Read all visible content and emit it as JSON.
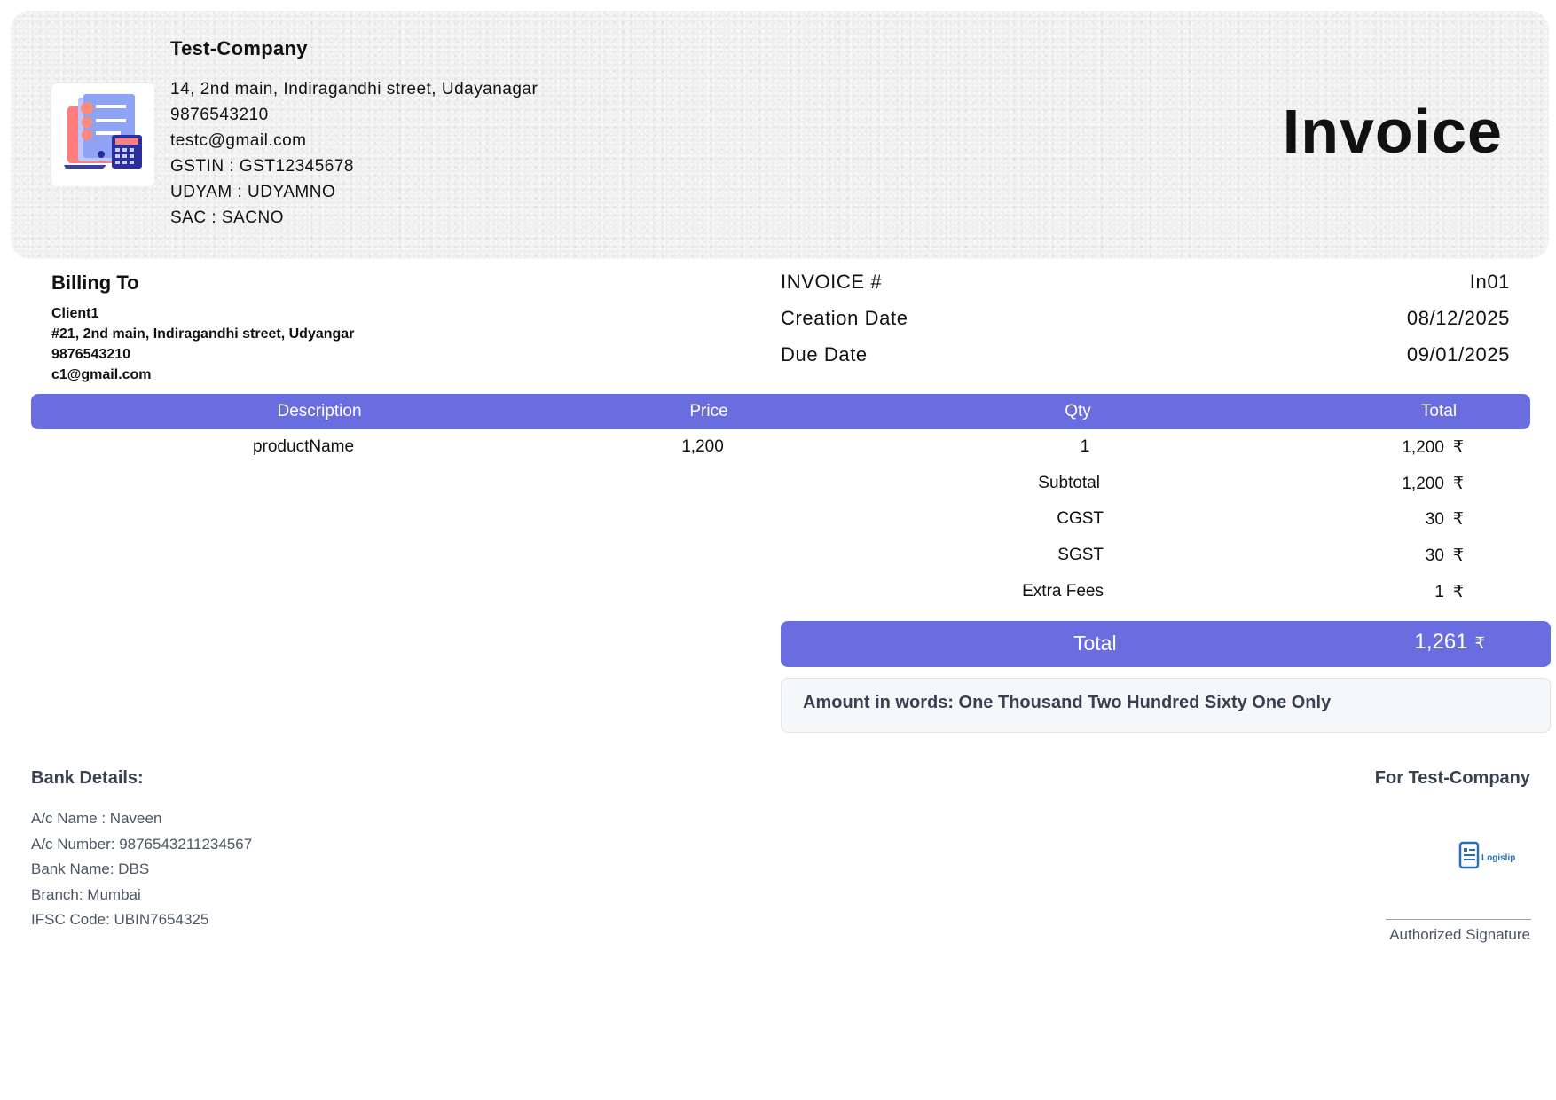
{
  "header": {
    "company_name": "Test-Company",
    "address": "14, 2nd main, Indiragandhi street, Udayanagar",
    "phone": "9876543210",
    "email": "testc@gmail.com",
    "gstin": "GSTIN : GST12345678",
    "udyam": "UDYAM : UDYAMNO",
    "sac": "SAC : SACNO",
    "title": "Invoice"
  },
  "billing": {
    "title": "Billing To",
    "client_name": "Client1",
    "address": "#21, 2nd main, Indiragandhi street, Udyangar",
    "phone": "9876543210",
    "email": "c1@gmail.com"
  },
  "meta": {
    "invoice_label": "INVOICE #",
    "invoice_value": "In01",
    "creation_label": "Creation Date",
    "creation_value": "08/12/2025",
    "due_label": "Due Date",
    "due_value": "09/01/2025"
  },
  "table": {
    "headers": [
      "Description",
      "Price",
      "Qty",
      "Total"
    ],
    "rows": [
      {
        "description": "productName",
        "price": "1,200",
        "qty": "1",
        "total": "1,200"
      }
    ]
  },
  "currency": "₹",
  "summary": {
    "subtotal_label": "Subtotal",
    "subtotal_value": "1,200",
    "cgst_label": "CGST",
    "cgst_value": "30",
    "sgst_label": "SGST",
    "sgst_value": "30",
    "extra_label": "Extra Fees",
    "extra_value": "1",
    "total_label": "Total",
    "total_value": "1,261"
  },
  "amount_in_words": "Amount in words: One Thousand Two Hundred Sixty One Only",
  "bank": {
    "title": "Bank Details:",
    "ac_name": "A/c Name : Naveen",
    "ac_number": "A/c Number: 9876543211234567",
    "bank_name": "Bank Name: DBS",
    "branch": "Branch: Mumbai",
    "ifsc": "IFSC Code: UBIN7654325"
  },
  "signature": {
    "for_company": "For Test-Company",
    "logo_text": "Logislip",
    "caption": "Authorized Signature"
  },
  "colors": {
    "accent": "#6a6de0",
    "muted_text": "#4b5563",
    "dark_text": "#374151"
  },
  "icons": [
    "invoice-logo-icon",
    "logislip-logo-icon"
  ]
}
